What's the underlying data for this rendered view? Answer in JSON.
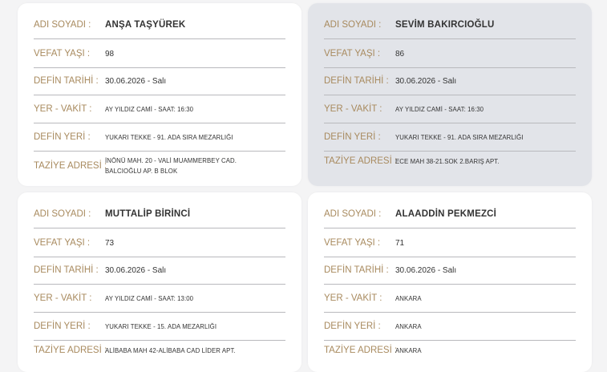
{
  "labels": {
    "name": "ADI SOYADI",
    "age": "VEFAT YAŞI",
    "burial_date": "DEFİN TARİHİ",
    "place_time": "YER - VAKİT",
    "burial_place": "DEFİN YERİ",
    "condolence": "TAZİYE ADRESİ",
    "colon": ":"
  },
  "records": [
    {
      "name": "ANŞA TAŞYÜREK",
      "age": "98",
      "burial_date": "30.06.2026 - Salı",
      "place_time": "AY YILDIZ CAMİ - SAAT: 16:30",
      "burial_place": "YUKARI TEKKE - 91. ADA SIRA MEZARLIĞI",
      "condolence": "İNÖNÜ MAH. 20 - VALİ MUAMMERBEY CAD. BALCIOĞLU AP. B BLOK"
    },
    {
      "name": "SEVİM BAKIRCIOĞLU",
      "age": "86",
      "burial_date": "30.06.2026 - Salı",
      "place_time": "AY YILDIZ CAMİ - SAAT: 16:30",
      "burial_place": "YUKARI TEKKE - 91. ADA SIRA MEZARLIĞI",
      "condolence": "ECE MAH 38-21.SOK 2.BARIŞ APT."
    },
    {
      "name": "MUTTALİP BİRİNCİ",
      "age": "73",
      "burial_date": "30.06.2026 - Salı",
      "place_time": "AY YILDIZ CAMİ - SAAT: 13:00",
      "burial_place": "YUKARI TEKKE - 15. ADA MEZARLIĞI",
      "condolence": "ALİBABA MAH 42-ALİBABA CAD LİDER APT."
    },
    {
      "name": "ALAADDİN PEKMEZCİ",
      "age": "71",
      "burial_date": "30.06.2026 - Salı",
      "place_time": "ANKARA",
      "burial_place": "ANKARA",
      "condolence": "ANKARA"
    }
  ],
  "colors": {
    "label": "#a88a5e",
    "value": "#333333",
    "card": "#ffffff",
    "card_active": "#e2e4e9",
    "background": "#f4f4f5",
    "separator": "#b9b9bd"
  }
}
